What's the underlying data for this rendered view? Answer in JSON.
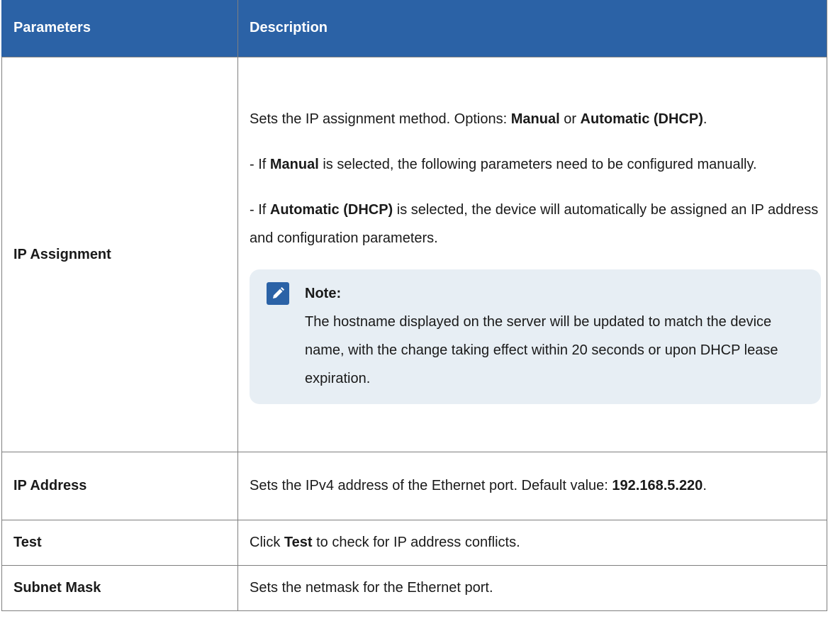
{
  "table": {
    "headers": {
      "param": "Parameters",
      "desc": "Description"
    },
    "rows": {
      "ip_assignment": {
        "param": "IP Assignment",
        "desc_p1_pre": "Sets the IP assignment method. Options: ",
        "desc_p1_b1": "Manual",
        "desc_p1_mid": " or ",
        "desc_p1_b2": "Automatic (DHCP)",
        "desc_p1_post": ".",
        "desc_p2_pre": "- If ",
        "desc_p2_b": "Manual",
        "desc_p2_post": " is selected, the following parameters need to be config­ured manually.",
        "desc_p3_pre": "- If ",
        "desc_p3_b": "Automatic (DHCP)",
        "desc_p3_post": " is selected, the device will automatically be as­signed an IP address and configuration parameters.",
        "note": {
          "icon": "pencil-icon",
          "title": "Note:",
          "text": "The hostname displayed on the server will be updated to match the device name, with the change taking effect within 20 seconds or upon DHCP lease expiration."
        }
      },
      "ip_address": {
        "param": "IP Address",
        "desc_pre": "Sets the IPv4 address of the Ethernet port. Default value: ",
        "desc_b": "192.168.5.220",
        "desc_post": "."
      },
      "test": {
        "param": "Test",
        "desc_pre": "Click ",
        "desc_b": "Test",
        "desc_post": " to check for IP address conflicts."
      },
      "subnet_mask": {
        "param": "Subnet Mask",
        "desc": "Sets the netmask for the Ethernet port."
      }
    }
  },
  "colors": {
    "header_bg": "#2b62a6",
    "note_bg": "#e7eef4",
    "border": "#7f7f7f"
  }
}
